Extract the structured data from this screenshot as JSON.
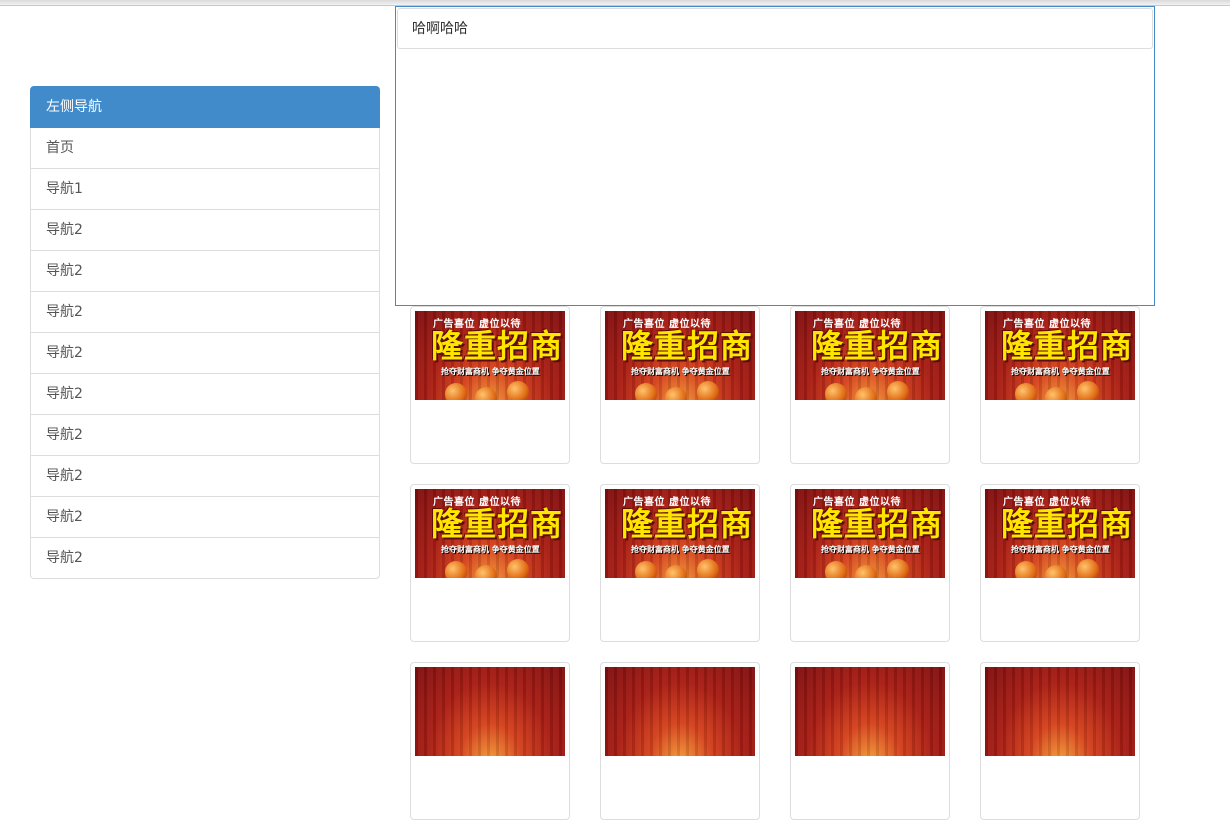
{
  "panel": {
    "heading": "哈啊哈哈"
  },
  "sidebar": {
    "items": [
      {
        "label": "左侧导航",
        "active": true
      },
      {
        "label": "首页"
      },
      {
        "label": "导航1"
      },
      {
        "label": "导航2"
      },
      {
        "label": "导航2"
      },
      {
        "label": "导航2"
      },
      {
        "label": "导航2"
      },
      {
        "label": "导航2"
      },
      {
        "label": "导航2"
      },
      {
        "label": "导航2"
      },
      {
        "label": "导航2"
      },
      {
        "label": "导航2"
      }
    ]
  },
  "ads": {
    "line1": "广告喜位 虚位以待",
    "main": "隆重招商",
    "line3": "抢夺财富商机 争夺黄金位置"
  },
  "colors": {
    "accent": "#428bca",
    "border": "#dddddd"
  }
}
